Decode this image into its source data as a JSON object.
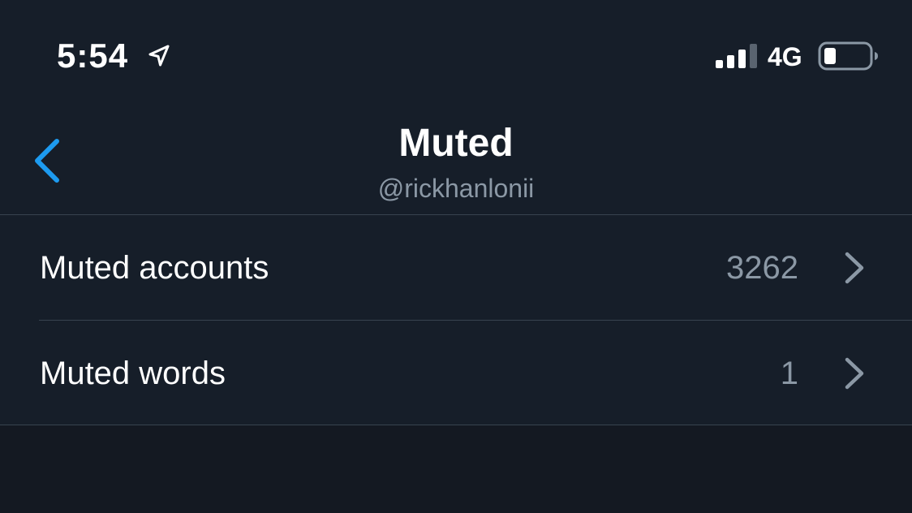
{
  "status_bar": {
    "time": "5:54",
    "network": "4G",
    "icons": [
      "location-arrow-icon",
      "cellular-signal-icon",
      "battery-icon"
    ]
  },
  "header": {
    "title": "Muted",
    "subtitle": "@rickhanlonii",
    "back_icon": "chevron-left-icon"
  },
  "settings": {
    "items": [
      {
        "label": "Muted accounts",
        "value": "3262",
        "icon": "chevron-right-icon"
      },
      {
        "label": "Muted words",
        "value": "1",
        "icon": "chevron-right-icon"
      }
    ]
  },
  "colors": {
    "background": "#141922",
    "surface": "#161e29",
    "accent": "#1d9bf0",
    "text_primary": "#ffffff",
    "text_secondary": "#8b98a5",
    "divider": "#38434f"
  }
}
